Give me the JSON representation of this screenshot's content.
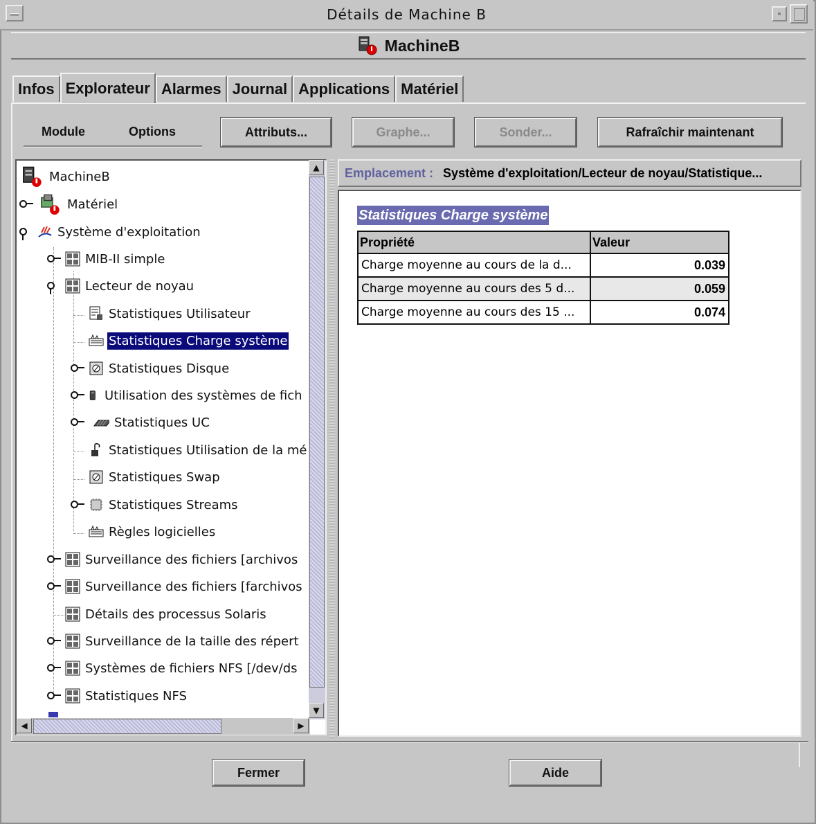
{
  "window": {
    "title": "Détails de Machine B"
  },
  "header": {
    "machine_name": "MachineB"
  },
  "tabs": [
    {
      "label": "Infos"
    },
    {
      "label": "Explorateur"
    },
    {
      "label": "Alarmes"
    },
    {
      "label": "Journal"
    },
    {
      "label": "Applications"
    },
    {
      "label": "Matériel"
    }
  ],
  "active_tab": "Explorateur",
  "toolbar": {
    "module_label": "Module",
    "options_label": "Options",
    "attributs_label": "Attributs...",
    "graphe_label": "Graphe...",
    "sonder_label": "Sonder...",
    "refresh_label": "Rafraîchir maintenant"
  },
  "tree": {
    "items": [
      {
        "label": "MachineB"
      },
      {
        "label": "Matériel"
      },
      {
        "label": "Système d'exploitation"
      },
      {
        "label": "MIB-II simple"
      },
      {
        "label": "Lecteur de noyau"
      },
      {
        "label": "Statistiques Utilisateur"
      },
      {
        "label": "Statistiques Charge système"
      },
      {
        "label": "Statistiques Disque"
      },
      {
        "label": "Utilisation des systèmes de fich"
      },
      {
        "label": "Statistiques UC"
      },
      {
        "label": "Statistiques Utilisation de la mé"
      },
      {
        "label": "Statistiques Swap"
      },
      {
        "label": "Statistiques Streams"
      },
      {
        "label": "Règles logicielles"
      },
      {
        "label": "Surveillance des fichiers [archivos"
      },
      {
        "label": "Surveillance des fichiers [farchivos"
      },
      {
        "label": "Détails des processus Solaris"
      },
      {
        "label": "Surveillance de la taille des répert"
      },
      {
        "label": "Systèmes de fichiers NFS [/dev/ds"
      },
      {
        "label": "Statistiques NFS"
      }
    ],
    "selected": "Statistiques Charge système"
  },
  "location": {
    "label": "Emplacement :",
    "path": "Système d'exploitation/Lecteur de noyau/Statistique..."
  },
  "content": {
    "title": "Statistiques Charge système",
    "columns": [
      "Propriété",
      "Valeur"
    ],
    "rows": [
      {
        "property": "Charge moyenne au cours de la d...",
        "value": "0.039"
      },
      {
        "property": "Charge moyenne au cours des 5 d...",
        "value": "0.059"
      },
      {
        "property": "Charge moyenne au cours des 15 ...",
        "value": "0.074"
      }
    ]
  },
  "footer": {
    "close_label": "Fermer",
    "help_label": "Aide"
  }
}
